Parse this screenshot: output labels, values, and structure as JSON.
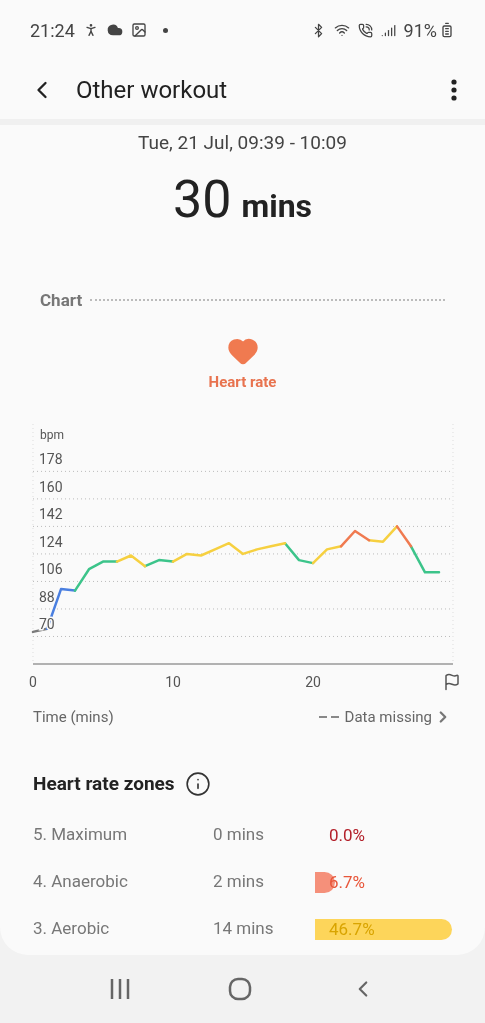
{
  "status_bar": {
    "time": "21:24",
    "battery": "91%"
  },
  "header": {
    "title": "Other workout"
  },
  "summary": {
    "date": "Tue, 21 Jul, 09:39 - 10:09",
    "duration_value": "30",
    "duration_unit": "mins"
  },
  "chart_section": {
    "title": "Chart",
    "metric": "Heart rate",
    "missing_label": "Data missing",
    "chart_data": {
      "type": "line",
      "ylabel": "bpm",
      "xlabel": "Time (mins)",
      "x": [
        0,
        1,
        2,
        3,
        4,
        5,
        6,
        7,
        8,
        9,
        10,
        11,
        12,
        13,
        14,
        15,
        16,
        17,
        18,
        19,
        20,
        21,
        22,
        23,
        24,
        25,
        26,
        27,
        28,
        29
      ],
      "xlim": [
        0,
        30
      ],
      "ylim": [
        52,
        209
      ],
      "grid": true,
      "xticks": [
        0,
        10,
        20
      ],
      "yticks": [
        70,
        88,
        106,
        124,
        142,
        160,
        178
      ],
      "series": [
        {
          "color": "#7a7a7a",
          "values": [
            73,
            75,
            null,
            null,
            null,
            null,
            null,
            null,
            null,
            null,
            null,
            null,
            null,
            null,
            null,
            null,
            null,
            null,
            null,
            null,
            null,
            null,
            null,
            null,
            null,
            null,
            null,
            null,
            null,
            null
          ]
        },
        {
          "color": "#4a7fe0",
          "values": [
            null,
            75,
            101,
            100,
            null,
            null,
            null,
            null,
            null,
            null,
            null,
            null,
            null,
            null,
            null,
            null,
            null,
            null,
            null,
            null,
            null,
            null,
            null,
            null,
            null,
            null,
            null,
            null,
            null,
            null
          ]
        },
        {
          "color": "#3cc48a",
          "values": [
            null,
            null,
            null,
            100,
            114,
            119,
            119,
            null,
            116,
            120,
            119,
            null,
            null,
            null,
            null,
            null,
            null,
            null,
            131,
            120,
            118,
            null,
            null,
            null,
            null,
            null,
            null,
            129,
            112,
            112
          ]
        },
        {
          "color": "#f6d040",
          "values": [
            null,
            null,
            null,
            null,
            null,
            null,
            119,
            123,
            116,
            null,
            119,
            124,
            123,
            127,
            131,
            124,
            127,
            129,
            131,
            null,
            118,
            127,
            129,
            null,
            133,
            132,
            142,
            null,
            null,
            null
          ]
        },
        {
          "color": "#f07a50",
          "values": [
            null,
            null,
            null,
            null,
            null,
            null,
            null,
            null,
            null,
            null,
            null,
            null,
            null,
            null,
            null,
            null,
            null,
            null,
            null,
            null,
            null,
            null,
            129,
            139,
            133,
            null,
            142,
            129,
            null,
            null
          ]
        }
      ]
    }
  },
  "zones": {
    "title": "Heart rate zones",
    "rows": [
      {
        "name": "5. Maximum",
        "duration": "0 mins",
        "percent": "0.0%",
        "color": "#b3202a"
      },
      {
        "name": "4. Anaerobic",
        "duration": "2 mins",
        "percent": "6.7%",
        "color": "#f5907a"
      },
      {
        "name": "3. Aerobic",
        "duration": "14 mins",
        "percent": "46.7%",
        "color": "#fdd55a"
      }
    ]
  }
}
